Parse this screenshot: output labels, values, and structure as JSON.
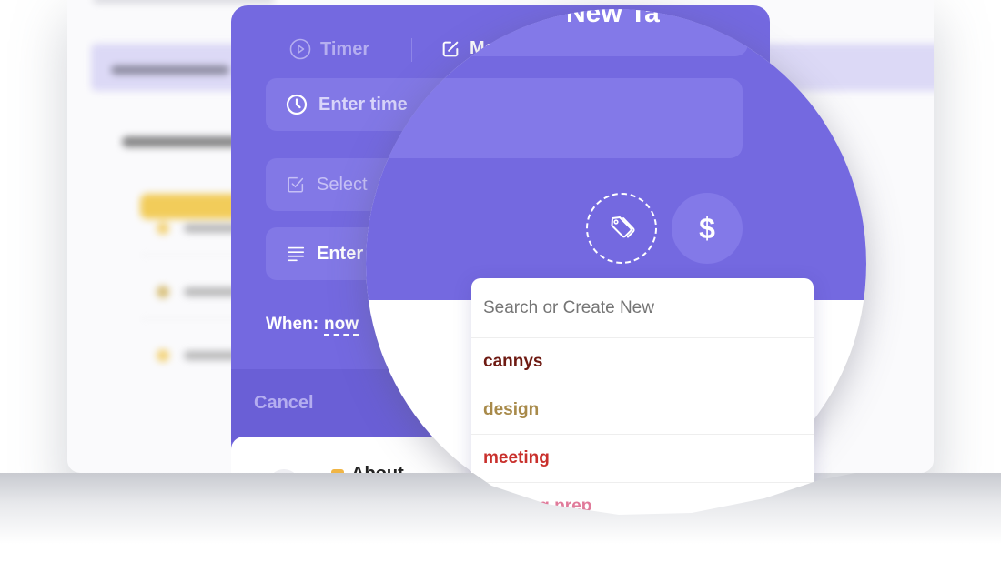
{
  "dialog": {
    "title": "New Ta",
    "minimize_icon": "minimize-icon",
    "tabs": [
      {
        "label": "Timer",
        "icon": "play-circle-icon"
      },
      {
        "label": "Ma",
        "icon": "edit-icon"
      }
    ],
    "fields": {
      "time_placeholder": "Enter time",
      "task_placeholder": "Select",
      "notes_placeholder": "Enter"
    },
    "when_label": "When:",
    "when_value": "now",
    "cancel_label": "Cancel",
    "task_preview": "About"
  },
  "actions": {
    "tag_icon": "tag-icon",
    "billable_label": "$"
  },
  "tag_dropdown": {
    "search_placeholder": "Search or Create New",
    "options": [
      {
        "label": "cannys",
        "color": "#6e1a12"
      },
      {
        "label": "design",
        "color": "#a88a4a"
      },
      {
        "label": "meeting",
        "color": "#c9302c"
      },
      {
        "label": "meeting prep",
        "color": "#e07a9a"
      }
    ]
  },
  "colors": {
    "accent": "#7469e0",
    "accent_light": "#8379e8"
  }
}
